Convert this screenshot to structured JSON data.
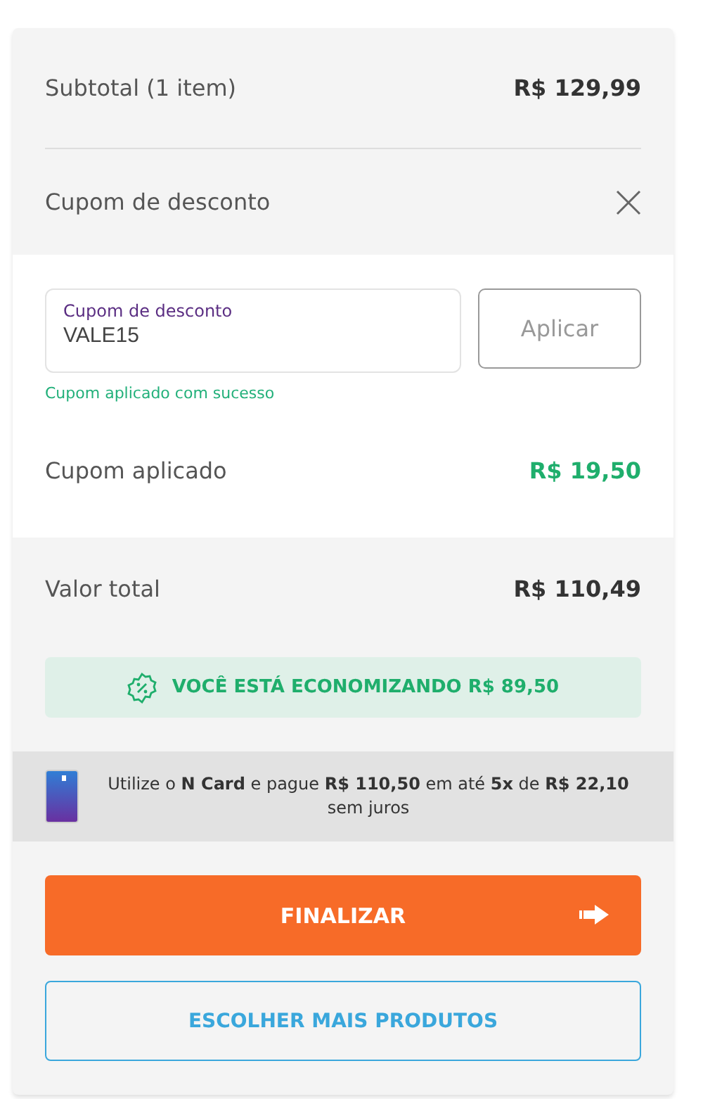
{
  "subtotal": {
    "label": "Subtotal (1 item)",
    "value": "R$ 129,99"
  },
  "coupon": {
    "title": "Cupom de desconto",
    "field_label": "Cupom de desconto",
    "value": "VALE15",
    "apply_button": "Aplicar",
    "message": "Cupom aplicado com sucesso",
    "applied_label": "Cupom aplicado",
    "applied_value": "R$ 19,50"
  },
  "total": {
    "label": "Valor total",
    "value": "R$ 110,49"
  },
  "savings": "VOCÊ ESTÁ ECONOMIZANDO R$ 89,50",
  "card_offer": "Utilize o **N Card** e pague **R$ 110,50** em até **5x** de **R$ 22,10** sem juros",
  "buttons": {
    "primary": "FINALIZAR",
    "secondary": "ESCOLHER MAIS PRODUTOS"
  }
}
